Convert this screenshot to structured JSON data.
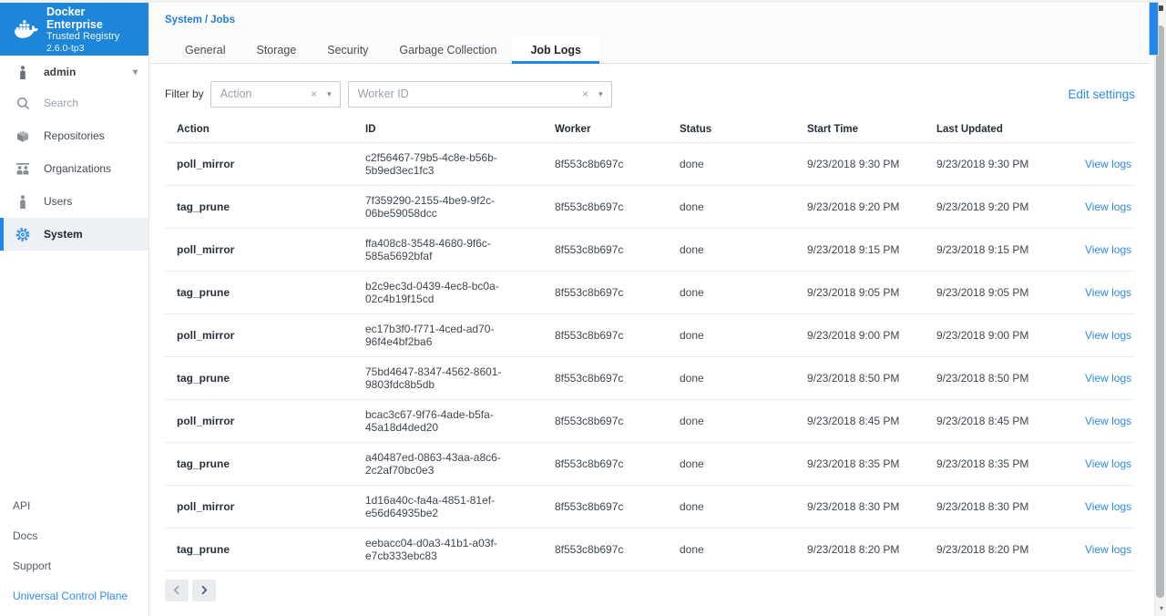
{
  "app": {
    "name": "Docker Enterprise",
    "product": "Trusted Registry",
    "version": "2.6.0-tp3"
  },
  "sidebar": {
    "user": {
      "label": "admin"
    },
    "search": {
      "label": "Search"
    },
    "items": [
      {
        "label": "Repositories"
      },
      {
        "label": "Organizations"
      },
      {
        "label": "Users"
      },
      {
        "label": "System",
        "active": true
      }
    ],
    "footer": [
      {
        "label": "API"
      },
      {
        "label": "Docs"
      },
      {
        "label": "Support"
      },
      {
        "label": "Universal Control Plane"
      }
    ]
  },
  "breadcrumb": {
    "section": "System",
    "separator": "/",
    "page": "Jobs"
  },
  "tabs": [
    {
      "label": "General"
    },
    {
      "label": "Storage"
    },
    {
      "label": "Security"
    },
    {
      "label": "Garbage Collection"
    },
    {
      "label": "Job Logs",
      "active": true
    }
  ],
  "filters": {
    "label": "Filter by",
    "action": {
      "placeholder": "Action"
    },
    "worker": {
      "placeholder": "Worker ID"
    }
  },
  "header_actions": {
    "edit_settings": "Edit settings"
  },
  "table": {
    "columns": [
      "Action",
      "ID",
      "Worker",
      "Status",
      "Start Time",
      "Last Updated"
    ],
    "view_logs_label": "View logs",
    "rows": [
      {
        "action": "poll_mirror",
        "id": "c2f56467-79b5-4c8e-b56b-5b9ed3ec1fc3",
        "worker": "8f553c8b697c",
        "status": "done",
        "start_time": "9/23/2018 9:30 PM",
        "last_updated": "9/23/2018 9:30 PM"
      },
      {
        "action": "tag_prune",
        "id": "7f359290-2155-4be9-9f2c-06be59058dcc",
        "worker": "8f553c8b697c",
        "status": "done",
        "start_time": "9/23/2018 9:20 PM",
        "last_updated": "9/23/2018 9:20 PM"
      },
      {
        "action": "poll_mirror",
        "id": "ffa408c8-3548-4680-9f6c-585a5692bfaf",
        "worker": "8f553c8b697c",
        "status": "done",
        "start_time": "9/23/2018 9:15 PM",
        "last_updated": "9/23/2018 9:15 PM"
      },
      {
        "action": "tag_prune",
        "id": "b2c9ec3d-0439-4ec8-bc0a-02c4b19f15cd",
        "worker": "8f553c8b697c",
        "status": "done",
        "start_time": "9/23/2018 9:05 PM",
        "last_updated": "9/23/2018 9:05 PM"
      },
      {
        "action": "poll_mirror",
        "id": "ec17b3f0-f771-4ced-ad70-96f4e4bf2ba6",
        "worker": "8f553c8b697c",
        "status": "done",
        "start_time": "9/23/2018 9:00 PM",
        "last_updated": "9/23/2018 9:00 PM"
      },
      {
        "action": "tag_prune",
        "id": "75bd4647-8347-4562-8601-9803fdc8b5db",
        "worker": "8f553c8b697c",
        "status": "done",
        "start_time": "9/23/2018 8:50 PM",
        "last_updated": "9/23/2018 8:50 PM"
      },
      {
        "action": "poll_mirror",
        "id": "bcac3c67-9f76-4ade-b5fa-45a18d4ded20",
        "worker": "8f553c8b697c",
        "status": "done",
        "start_time": "9/23/2018 8:45 PM",
        "last_updated": "9/23/2018 8:45 PM"
      },
      {
        "action": "tag_prune",
        "id": "a40487ed-0863-43aa-a8c6-2c2af70bc0e3",
        "worker": "8f553c8b697c",
        "status": "done",
        "start_time": "9/23/2018 8:35 PM",
        "last_updated": "9/23/2018 8:35 PM"
      },
      {
        "action": "poll_mirror",
        "id": "1d16a40c-fa4a-4851-81ef-e56d64935be2",
        "worker": "8f553c8b697c",
        "status": "done",
        "start_time": "9/23/2018 8:30 PM",
        "last_updated": "9/23/2018 8:30 PM"
      },
      {
        "action": "tag_prune",
        "id": "eebacc04-d0a3-41b1-a03f-e7cb333ebc83",
        "worker": "8f553c8b697c",
        "status": "done",
        "start_time": "9/23/2018 8:20 PM",
        "last_updated": "9/23/2018 8:20 PM"
      }
    ]
  },
  "pagination": {
    "prev": "chevron-left",
    "next": "chevron-right"
  },
  "icons": {
    "clear": "×",
    "caret": "▾",
    "user_caret": "▾",
    "scroll_down": "▾"
  },
  "colors": {
    "accent": "#2287e8",
    "header_blue": "#1e86d8",
    "link_blue": "#2e8ce8",
    "breadcrumb_blue": "#1f7fd8",
    "active_item_bg": "#edf0f4"
  }
}
